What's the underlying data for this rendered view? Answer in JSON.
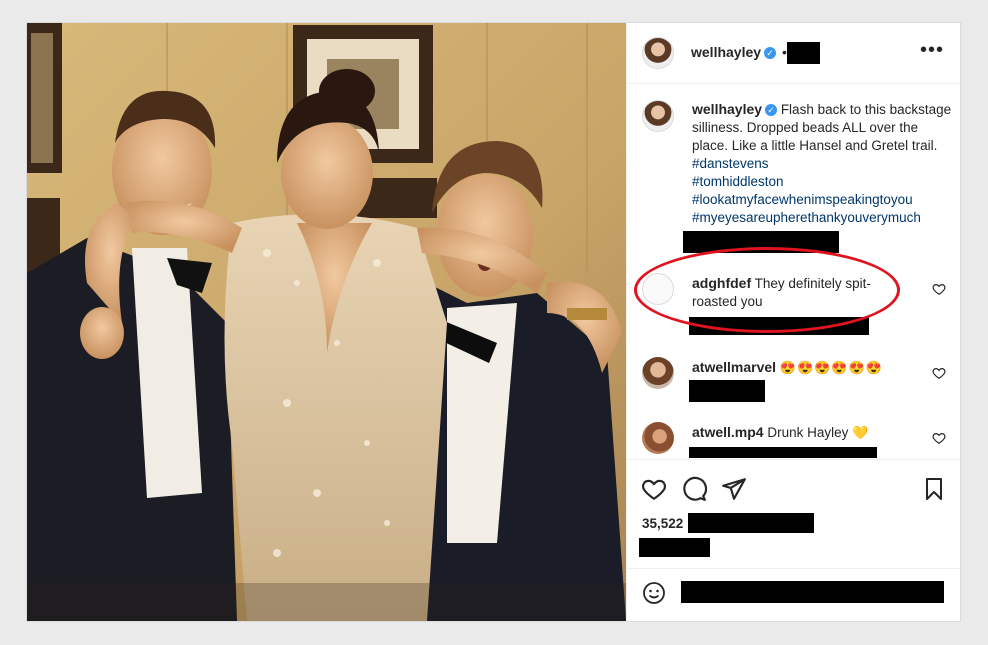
{
  "post": {
    "username": "wellhayley",
    "more_icon": "more-horizontal-icon",
    "caption_user": "wellhayley",
    "caption": "Flash back to this backstage silliness. Dropped beads ALL over the place. Like a little Hansel and Gretel trail.",
    "hashtags": [
      "#danstevens",
      "#tomhiddleston",
      "#lookatmyfacewhenimspeakingtoyou",
      "#myeyesareupherethankyouverymuch"
    ]
  },
  "comments": [
    {
      "user": "adghfdef",
      "text": "They definitely spit-roasted you",
      "emoji": ""
    },
    {
      "user": "atwellmarvel",
      "text": "",
      "emoji": "😍😍😍😍😍😍"
    },
    {
      "user": "atwell.mp4",
      "text": "Drunk Hayley",
      "emoji": "💛"
    }
  ],
  "likes": {
    "count": "35,522"
  },
  "icons": [
    "heart-icon",
    "comment-icon",
    "share-icon",
    "bookmark-icon",
    "emoji-icon"
  ],
  "colors": {
    "hashtag": "#00376b",
    "verified": "#3897f0",
    "highlight": "#e0141f"
  }
}
